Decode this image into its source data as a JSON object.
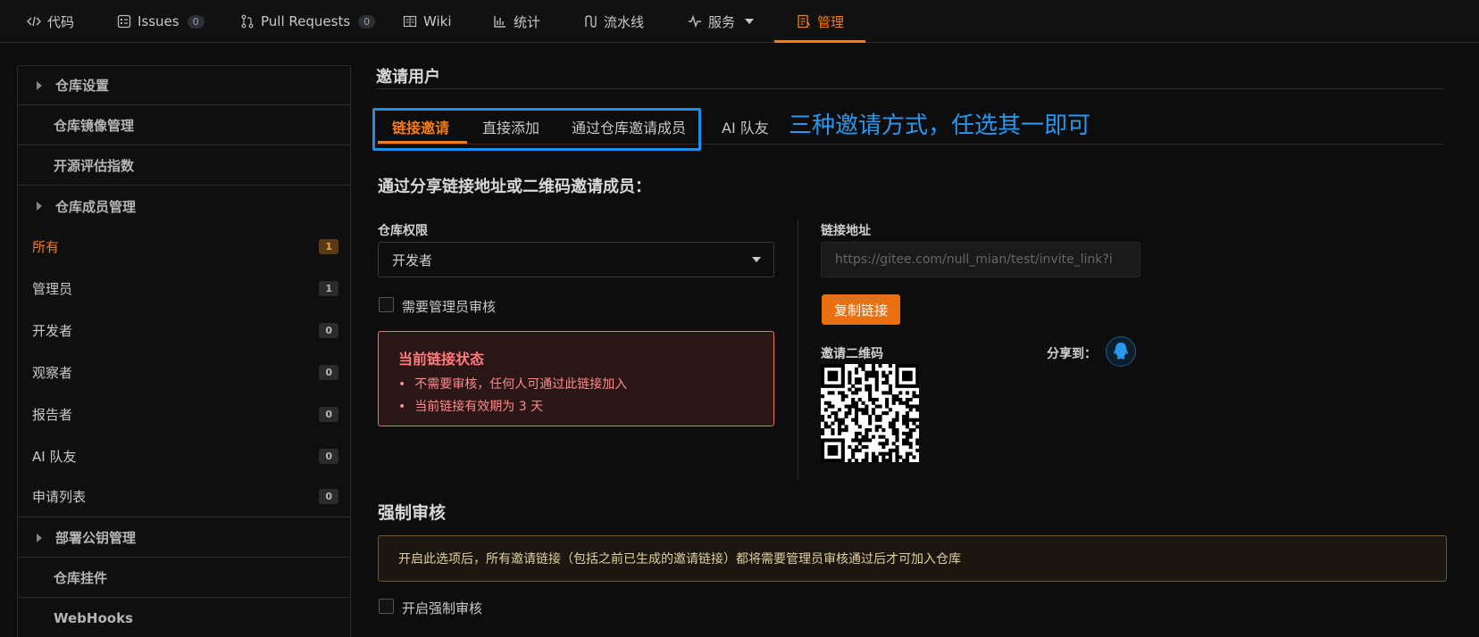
{
  "topnav": {
    "items": [
      {
        "label": "代码",
        "icon": "code-icon"
      },
      {
        "label": "Issues",
        "icon": "issues-icon",
        "badge": "0"
      },
      {
        "label": "Pull Requests",
        "icon": "pull-request-icon",
        "badge": "0"
      },
      {
        "label": "Wiki",
        "icon": "wiki-icon"
      },
      {
        "label": "统计",
        "icon": "chart-icon"
      },
      {
        "label": "流水线",
        "icon": "pipeline-icon"
      },
      {
        "label": "服务",
        "icon": "pulse-icon"
      },
      {
        "label": "管理",
        "icon": "manage-icon",
        "active": true
      }
    ]
  },
  "sidebar": {
    "groups": [
      {
        "label": "仓库设置"
      },
      {
        "label": "仓库镜像管理"
      },
      {
        "label": "开源评估指数"
      },
      {
        "label": "仓库成员管理"
      }
    ],
    "members": [
      {
        "label": "所有",
        "count": "1",
        "active": true
      },
      {
        "label": "管理员",
        "count": "1"
      },
      {
        "label": "开发者",
        "count": "0"
      },
      {
        "label": "观察者",
        "count": "0"
      },
      {
        "label": "报告者",
        "count": "0"
      },
      {
        "label": "AI 队友",
        "count": "0"
      },
      {
        "label": "申请列表",
        "count": "0"
      }
    ],
    "bottom": [
      {
        "label": "部署公钥管理"
      },
      {
        "label": "仓库挂件"
      },
      {
        "label": "WebHooks"
      }
    ]
  },
  "main": {
    "title": "邀请用户",
    "tabs": [
      {
        "label": "链接邀请",
        "active": true
      },
      {
        "label": "直接添加"
      },
      {
        "label": "通过仓库邀请成员"
      },
      {
        "label": "AI 队友"
      }
    ],
    "annotation": "三种邀请方式，任选其一即可",
    "subhead": "通过分享链接地址或二维码邀请成员：",
    "permission_label": "仓库权限",
    "permission_value": "开发者",
    "require_review_label": "需要管理员审核",
    "status": {
      "title": "当前链接状态",
      "items": [
        "不需要审核，任何人可通过此链接加入",
        "当前链接有效期为 3 天"
      ]
    },
    "link_label": "链接地址",
    "link_placeholder": "https://gitee.com/null_mian/test/invite_link?i",
    "copy_button": "复制链接",
    "qr_label": "邀请二维码",
    "share_label": "分享到：",
    "force": {
      "title": "强制审核",
      "notice": "开启此选项后，所有邀请链接（包括之前已生成的邀请链接）都将需要管理员审核通过后才可加入仓库",
      "checkbox_label": "开启强制审核"
    }
  },
  "colors": {
    "accent": "#f07c1b",
    "annotation": "#2a97ee",
    "danger": "#ff7b7b"
  }
}
